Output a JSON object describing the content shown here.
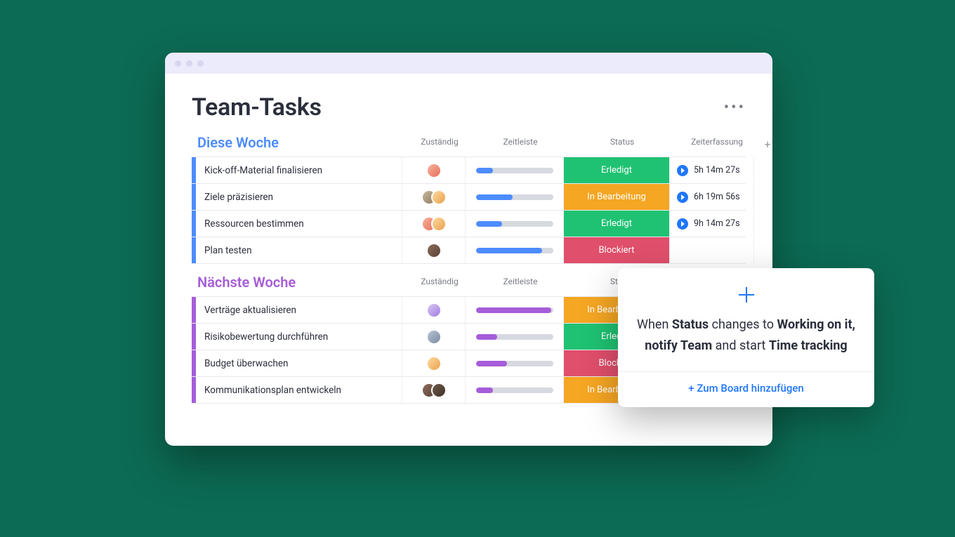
{
  "board": {
    "title": "Team-Tasks",
    "more_label": "•••"
  },
  "columns": {
    "owner": "Zuständig",
    "timeline": "Zeitleiste",
    "status": "Status",
    "time_tracking": "Zeiterfassung",
    "add": "+"
  },
  "status_labels": {
    "done": "Erledigt",
    "working": "In Bearbeitung",
    "blocked": "Blockiert"
  },
  "groups": [
    {
      "title": "Diese Woche",
      "accent": "blue",
      "rows": [
        {
          "name": "Kick-off-Material finalisieren",
          "owners": [
            "av1"
          ],
          "progress": 22,
          "status": "done",
          "time": "5h 14m 27s"
        },
        {
          "name": "Ziele präzisieren",
          "owners": [
            "av2",
            "av3"
          ],
          "progress": 48,
          "status": "working",
          "time": "6h 19m 56s"
        },
        {
          "name": "Ressourcen bestimmen",
          "owners": [
            "av1",
            "av3"
          ],
          "progress": 34,
          "status": "done",
          "time": "9h 14m 27s"
        },
        {
          "name": "Plan testen",
          "owners": [
            "av4"
          ],
          "progress": 86,
          "status": "blocked",
          "time": ""
        }
      ]
    },
    {
      "title": "Nächste Woche",
      "accent": "purple",
      "rows": [
        {
          "name": "Verträge aktualisieren",
          "owners": [
            "av5"
          ],
          "progress": 98,
          "status": "working",
          "time": ""
        },
        {
          "name": "Risikobewertung durchführen",
          "owners": [
            "av6"
          ],
          "progress": 28,
          "status": "done",
          "time": ""
        },
        {
          "name": "Budget überwachen",
          "owners": [
            "av3"
          ],
          "progress": 40,
          "status": "blocked",
          "time": ""
        },
        {
          "name": "Kommunikationsplan entwickeln",
          "owners": [
            "av4",
            "av7"
          ],
          "progress": 22,
          "status": "working",
          "time": ""
        }
      ]
    }
  ],
  "popup": {
    "text_pre": "When ",
    "b1": "Status",
    "text_mid1": " changes to ",
    "b2": "Working on it, notify Team",
    "text_mid2": " and start ",
    "b3": "Time tracking",
    "action": "+ Zum Board hinzufügen"
  }
}
